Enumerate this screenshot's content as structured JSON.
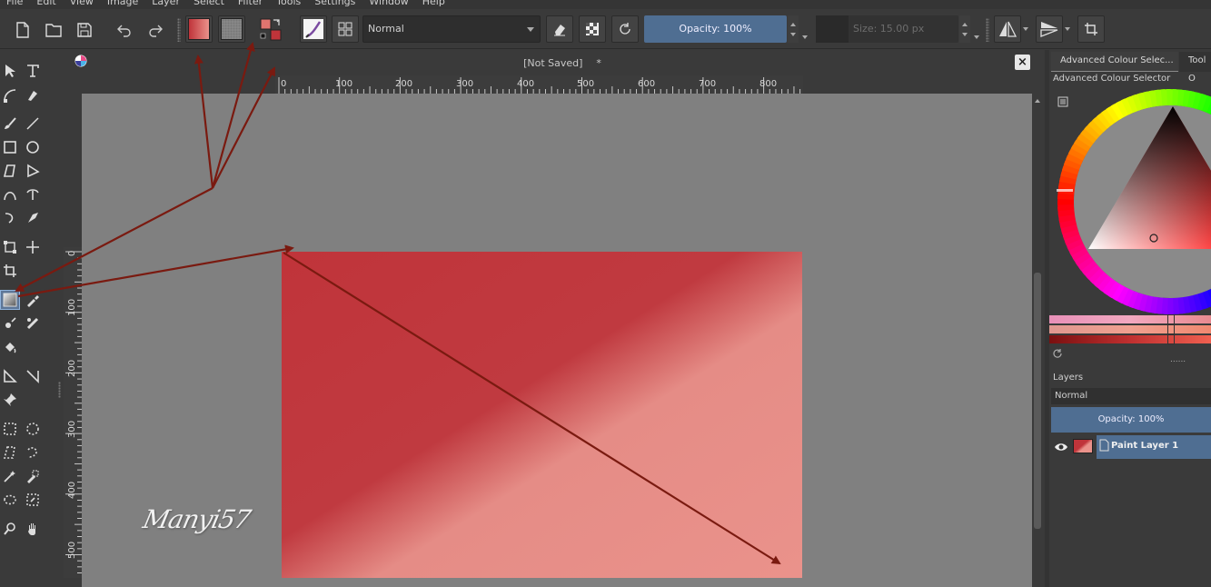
{
  "menu": [
    "File",
    "Edit",
    "View",
    "Image",
    "Layer",
    "Select",
    "Filter",
    "Tools",
    "Settings",
    "Window",
    "Help"
  ],
  "toolbar": {
    "blend_mode": "Normal",
    "opacity_label": "Opacity: 100%",
    "size_label": "Size: 15.00 px",
    "foreground_color": "#c0343a",
    "background_color": "#8a8a8a"
  },
  "document": {
    "title": "[Not Saved]",
    "modified_marker": "*"
  },
  "ruler_top": [
    "0",
    "100",
    "200",
    "300",
    "400",
    "500",
    "600",
    "700",
    "800"
  ],
  "ruler_left": [
    "0",
    "100",
    "200",
    "300",
    "400",
    "500"
  ],
  "gradient": {
    "start_color": "#c0343a",
    "end_color": "#ea928b"
  },
  "signature": "Manyi57",
  "dock": {
    "tabs": [
      "Advanced Colour Selec...",
      "Tool O"
    ],
    "colour_selector_title": "Advanced Colour Selector",
    "layers_title": "Layers",
    "layers_blend_mode": "Normal",
    "layers_opacity": "Opacity:  100%",
    "layer_name": "Paint Layer 1",
    "slider_grip": "......"
  },
  "annotation_color": "#7a1a10"
}
